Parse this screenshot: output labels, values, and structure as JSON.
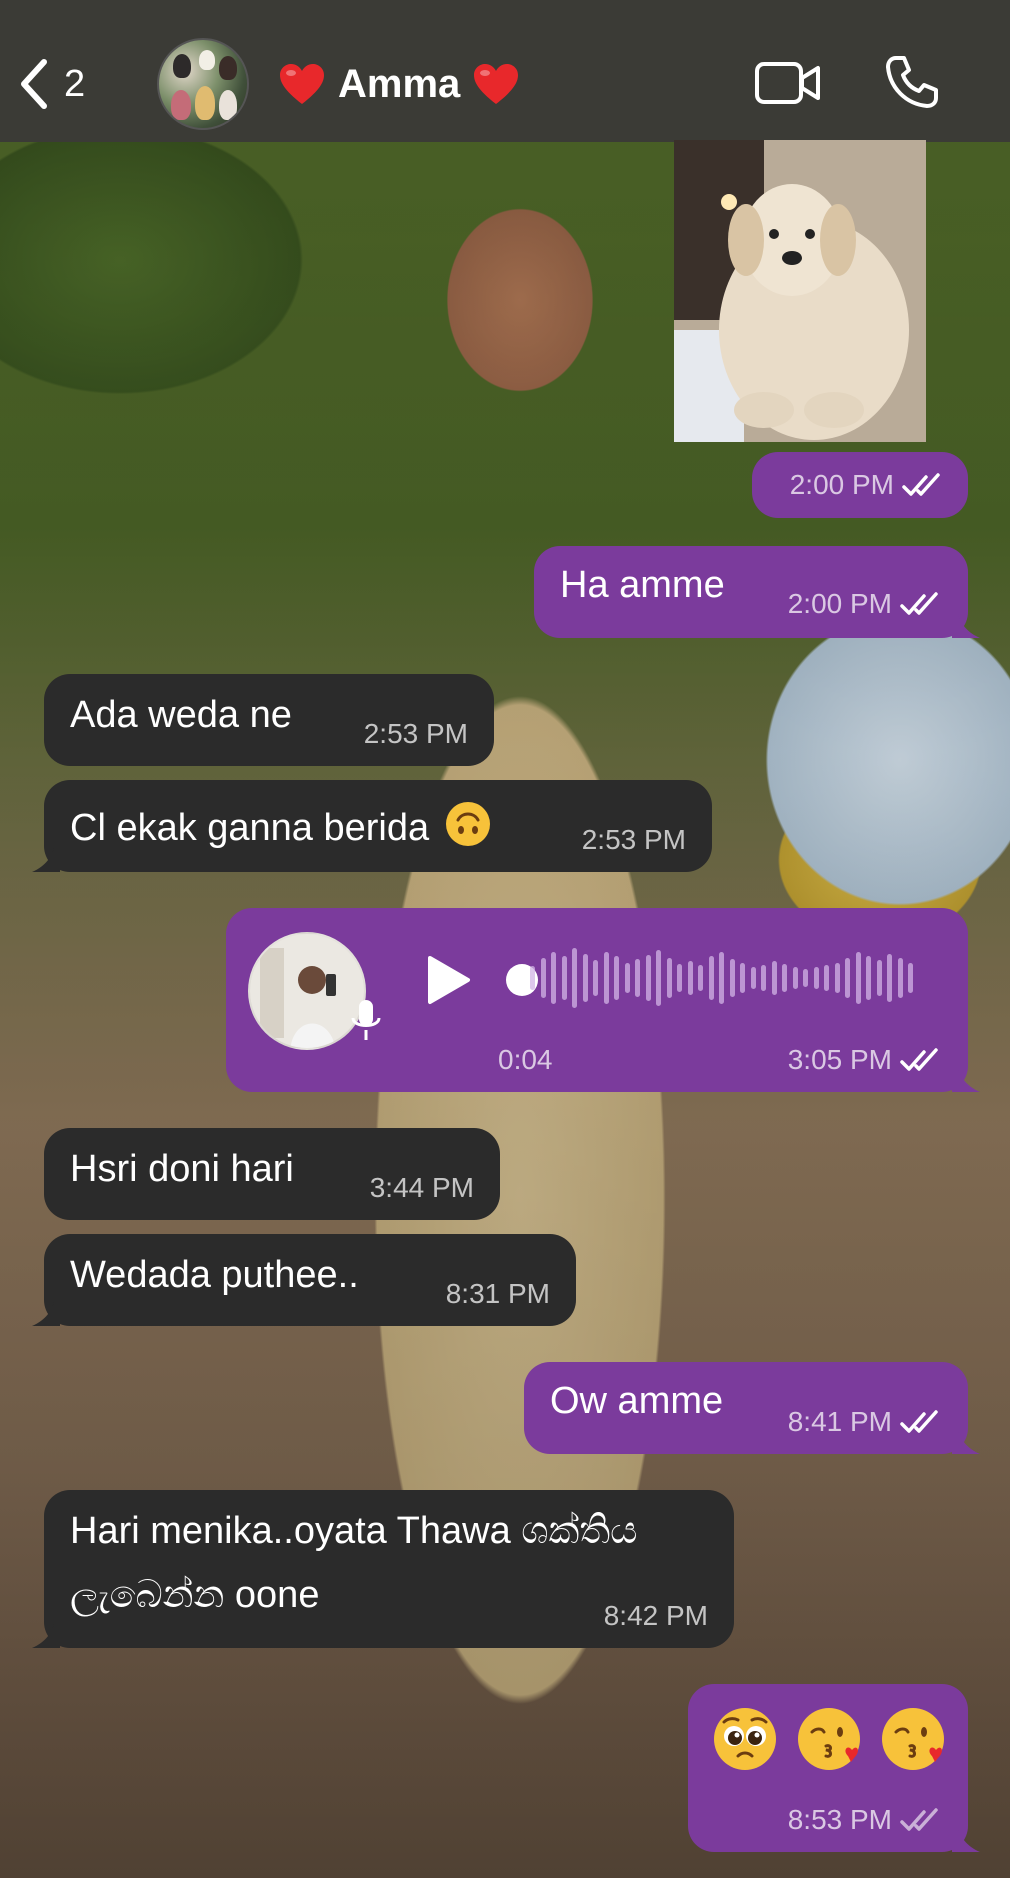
{
  "header": {
    "back_count": "2",
    "title": "Amma",
    "title_emoji": "red-heart"
  },
  "messages": [
    {
      "id": "m1",
      "direction": "out",
      "kind": "photo",
      "time": "2:00 PM",
      "status": "read"
    },
    {
      "id": "m2",
      "direction": "out",
      "kind": "text",
      "text": "Ha amme",
      "time": "2:00 PM",
      "status": "read"
    },
    {
      "id": "m3",
      "direction": "in",
      "kind": "text",
      "text": "Ada weda ne",
      "time": "2:53 PM"
    },
    {
      "id": "m4",
      "direction": "in",
      "kind": "text",
      "text": "Cl ekak ganna berida",
      "emoji": "upside-down-face",
      "time": "2:53 PM"
    },
    {
      "id": "m5",
      "direction": "out",
      "kind": "voice",
      "duration": "0:04",
      "time": "3:05 PM",
      "status": "read"
    },
    {
      "id": "m6",
      "direction": "in",
      "kind": "text",
      "text": "Hsri doni hari",
      "time": "3:44 PM"
    },
    {
      "id": "m7",
      "direction": "in",
      "kind": "text",
      "text": "Wedada puthee..",
      "time": "8:31 PM"
    },
    {
      "id": "m8",
      "direction": "out",
      "kind": "text",
      "text": "Ow amme",
      "time": "8:41 PM",
      "status": "read"
    },
    {
      "id": "m9",
      "direction": "in",
      "kind": "text",
      "text_line1": "Hari menika..oyata Thawa ශක්තිය",
      "text_line2": "ලැබෙන්න oone",
      "time": "8:42 PM"
    },
    {
      "id": "m10",
      "direction": "out",
      "kind": "emoji",
      "emojis": [
        "pleading-face",
        "face-blowing-kiss",
        "face-blowing-kiss"
      ],
      "time": "8:53 PM",
      "status": "sent"
    }
  ],
  "colors": {
    "header_bg": "#3b3b36",
    "incoming_bubble": "#2b2b2b",
    "outgoing_bubble": "#7b3b9c",
    "heart": "#e8282b"
  }
}
